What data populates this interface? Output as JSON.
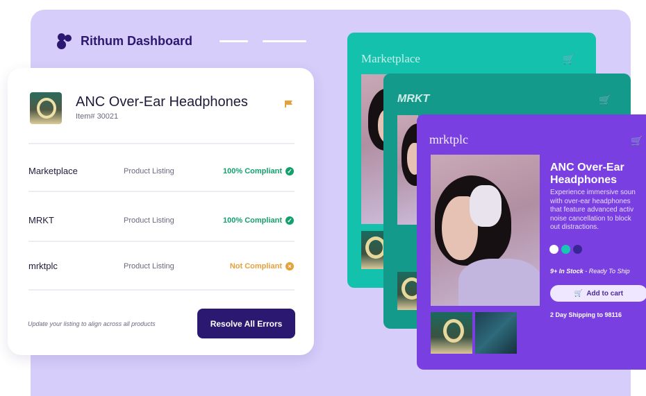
{
  "brand": {
    "name": "Rithum Dashboard"
  },
  "product": {
    "title": "ANC Over-Ear Headphones",
    "item": "Item# 30021"
  },
  "listings": [
    {
      "channel": "Marketplace",
      "type": "Product Listing",
      "status": "100% Compliant",
      "state": "ok"
    },
    {
      "channel": "MRKT",
      "type": "Product Listing",
      "status": "100% Compliant",
      "state": "ok"
    },
    {
      "channel": "mrktplc",
      "type": "Product Listing",
      "status": "Not Compliant",
      "state": "error"
    }
  ],
  "footer": {
    "note": "Update your listing to align across all products",
    "resolve_label": "Resolve All Errors"
  },
  "storefronts": {
    "teal": {
      "title": "Marketplace"
    },
    "green": {
      "title": "MRKT"
    },
    "purple": {
      "title": "mrktplc",
      "product_title": "ANC Over-Ear Headphones",
      "description_lines": [
        "Experience immersive soun",
        "with over-ear headphones",
        "that feature advanced activ",
        "noise cancellation to block",
        "out distractions."
      ],
      "swatches": [
        "#ffffff",
        "#18c6b3",
        "#3a2596"
      ],
      "stock_bold": "9+ In Stock",
      "stock_rest": " - Ready To Ship",
      "add_to_cart": "Add to cart",
      "shipping": "2 Day Shipping to 98116"
    }
  },
  "colors": {
    "navy": "#2b1870",
    "compliant": "#13a06c",
    "warning": "#e6a03a",
    "lavender": "#d6cdfa"
  }
}
